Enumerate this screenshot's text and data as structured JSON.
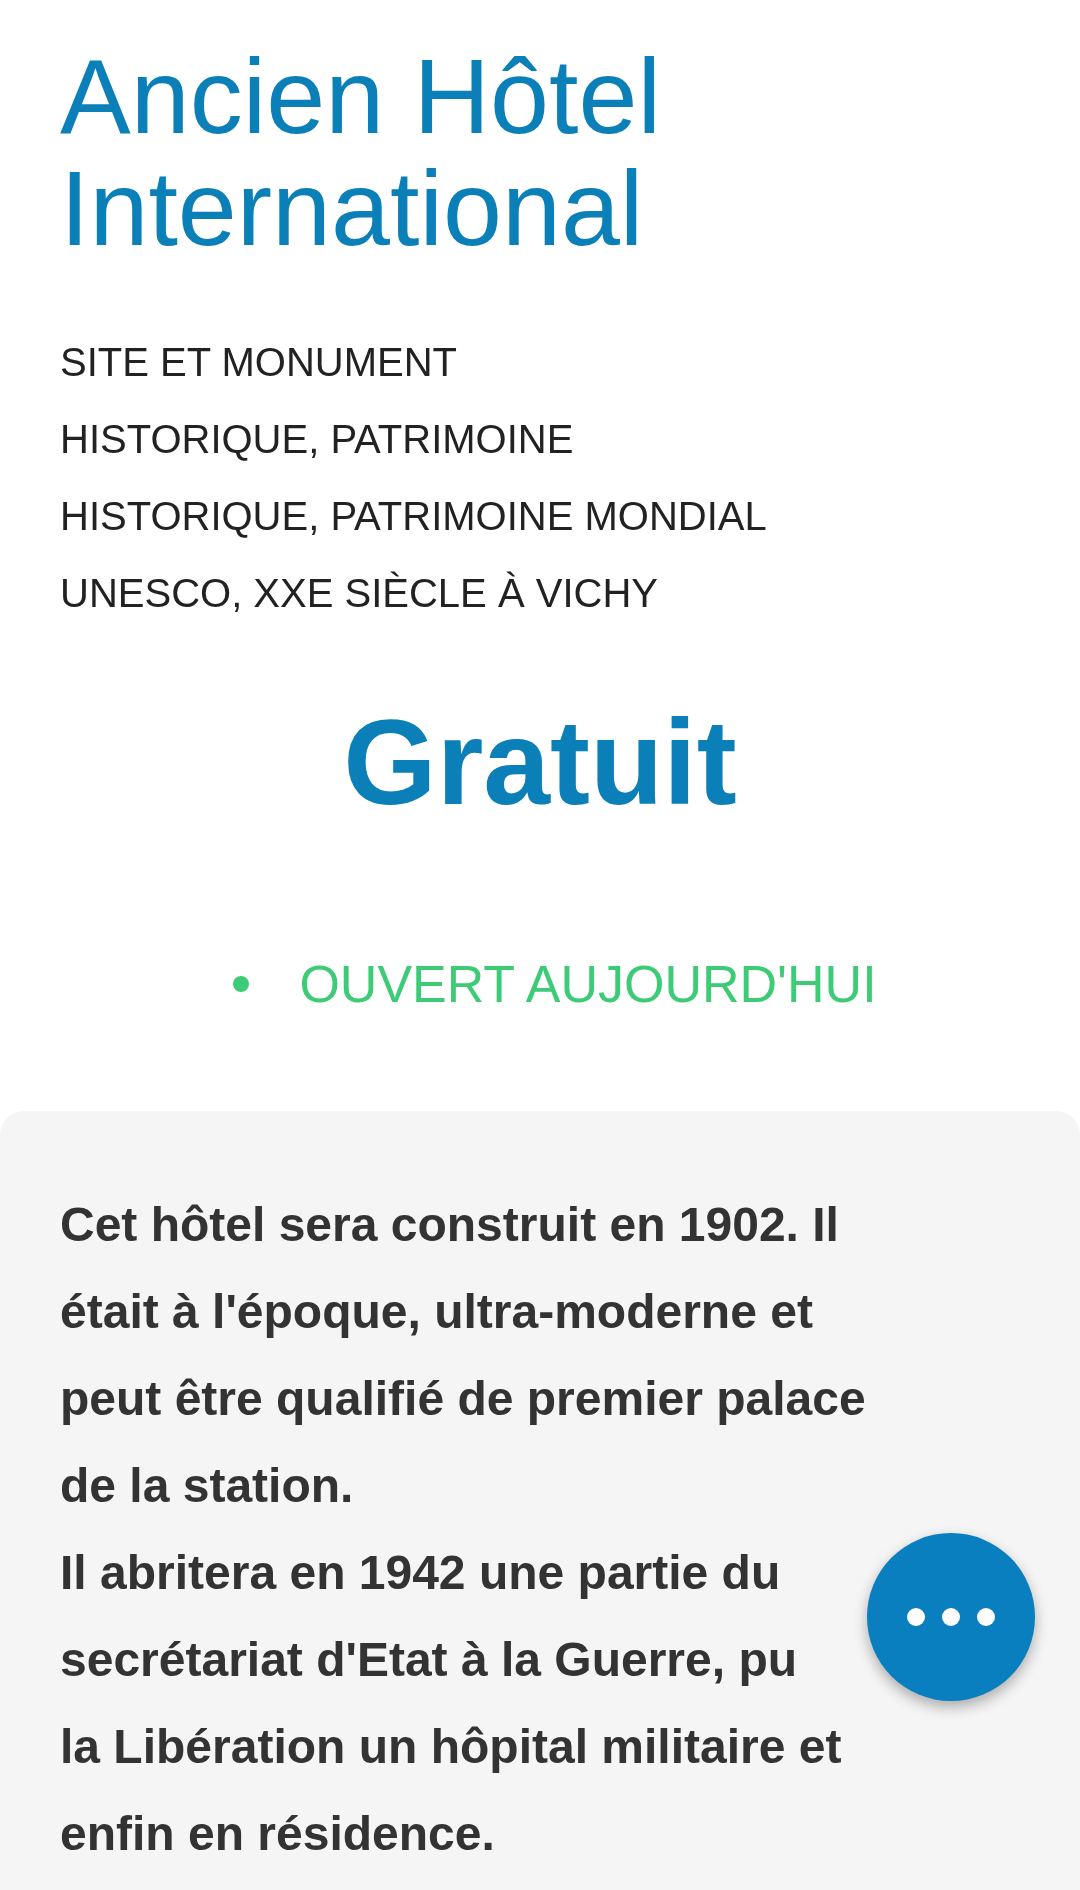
{
  "title": "Ancien Hôtel\nInternational",
  "categories": "SITE ET MONUMENT\nHISTORIQUE, PATRIMOINE\nHISTORIQUE, PATRIMOINE MONDIAL\nUNESCO, XXE SIÈCLE À VICHY",
  "price": "Gratuit",
  "status": {
    "label": "OUVERT AUJOURD'HUI",
    "open": true
  },
  "description": [
    "Cet hôtel sera construit en 1902. Il\nétait à l'époque, ultra-moderne et\npeut être qualifié de premier palace\nde la station.",
    "Il abritera en 1942 une partie du\nsecrétariat d'Etat à la Guerre, pu\nla Libération un hôpital militaire et\nenfin en résidence."
  ],
  "fab": {
    "kind": "more"
  }
}
